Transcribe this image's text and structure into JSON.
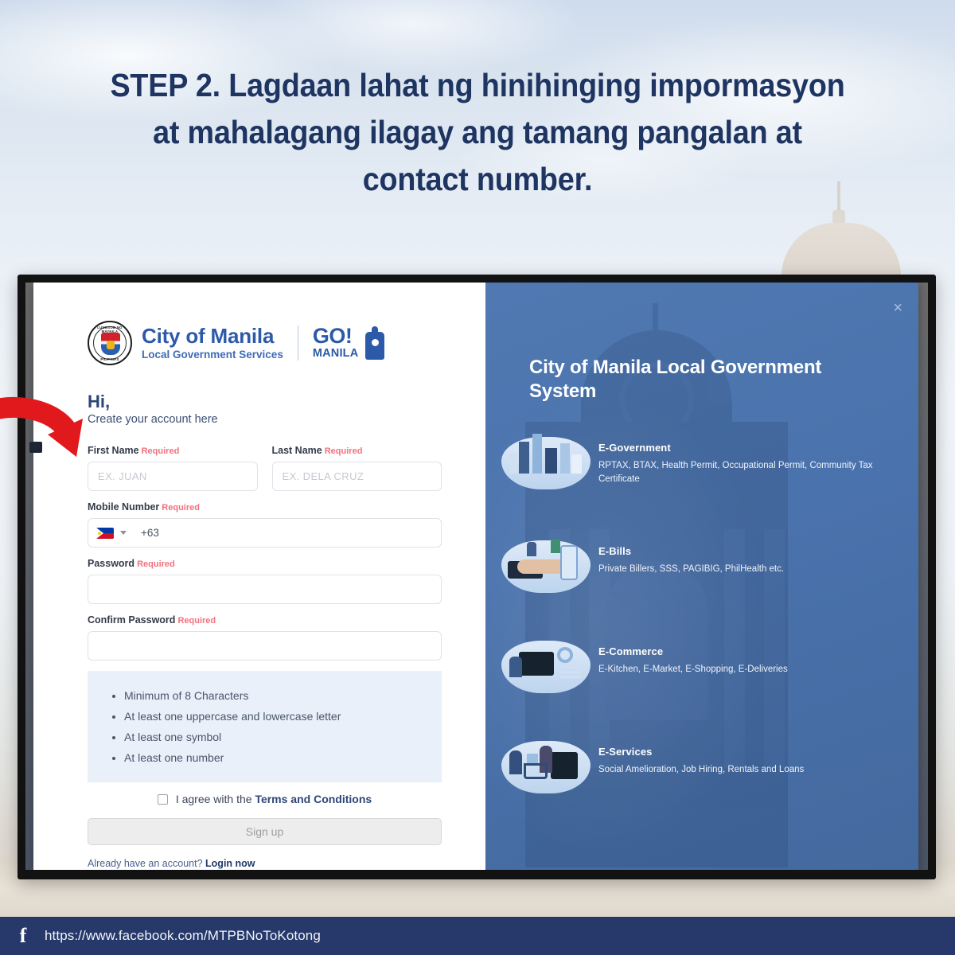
{
  "headline": {
    "line1": "STEP 2. Lagdaan lahat ng hinihinging impormasyon",
    "line2": "at mahalagang ilagay ang tamang pangalan at",
    "line3": "contact number."
  },
  "colors": {
    "headline": "#1e3461",
    "panel_blue": "#4a74ad",
    "brand_blue": "#2c5aa8",
    "required_red": "#f2717c",
    "footer_navy": "#27386b",
    "arrow_red": "#e2191c",
    "rules_bg": "#e9f0fa"
  },
  "dialog": {
    "close_label": "×",
    "logo": {
      "seal_top_text": "LUNGSOD NG MAYNILA",
      "seal_bottom_text": "PILIPINAS",
      "brand_main": "City of Manila",
      "brand_sub": "Local Government Services",
      "go_line1": "GO!",
      "go_line2": "MANILA"
    },
    "greeting": {
      "title": "Hi,",
      "subtitle": "Create your account here"
    },
    "form": {
      "fields": [
        {
          "label": "First Name",
          "required_text": "Required",
          "placeholder": "EX. JUAN",
          "value": ""
        },
        {
          "label": "Last Name",
          "required_text": "Required",
          "placeholder": "EX. DELA CRUZ",
          "value": ""
        },
        {
          "label": "Mobile Number",
          "required_text": "Required",
          "placeholder": "",
          "value": ""
        },
        {
          "label": "Password",
          "required_text": "Required",
          "placeholder": "",
          "value": ""
        },
        {
          "label": "Confirm Password",
          "required_text": "Required",
          "placeholder": "",
          "value": ""
        }
      ],
      "phone": {
        "country_flag": "philippines-flag-icon",
        "dial_code": "+63"
      },
      "password_rules": [
        "Minimum of 8 Characters",
        "At least one uppercase and lowercase letter",
        "At least one symbol",
        "At least one number"
      ],
      "terms": {
        "checked": false,
        "text": "I agree with the",
        "link": "Terms and Conditions"
      },
      "signup_label": "Sign up",
      "login_prompt": "Already have an account?",
      "login_link": "Login now"
    }
  },
  "right_panel": {
    "title": "City of Manila Local Government System",
    "services": [
      {
        "icon": "city-illustration-icon",
        "title": "E-Government",
        "desc": "RPTAX, BTAX, Health Permit, Occupational Permit, Community Tax Certificate"
      },
      {
        "icon": "handshake-illustration-icon",
        "title": "E-Bills",
        "desc": "Private Billers, SSS, PAGIBIG, PhilHealth etc."
      },
      {
        "icon": "ecommerce-illustration-icon",
        "title": "E-Commerce",
        "desc": "E-Kitchen, E-Market, E-Shopping, E-Deliveries"
      },
      {
        "icon": "services-illustration-icon",
        "title": "E-Services",
        "desc": "Social Amelioration, Job Hiring, Rentals and Loans"
      }
    ]
  },
  "annotation": {
    "arrow": "red-curved-arrow pointing to First Name field"
  },
  "footer": {
    "icon": "facebook-icon",
    "url": "https://www.facebook.com/MTPBNoToKotong"
  }
}
